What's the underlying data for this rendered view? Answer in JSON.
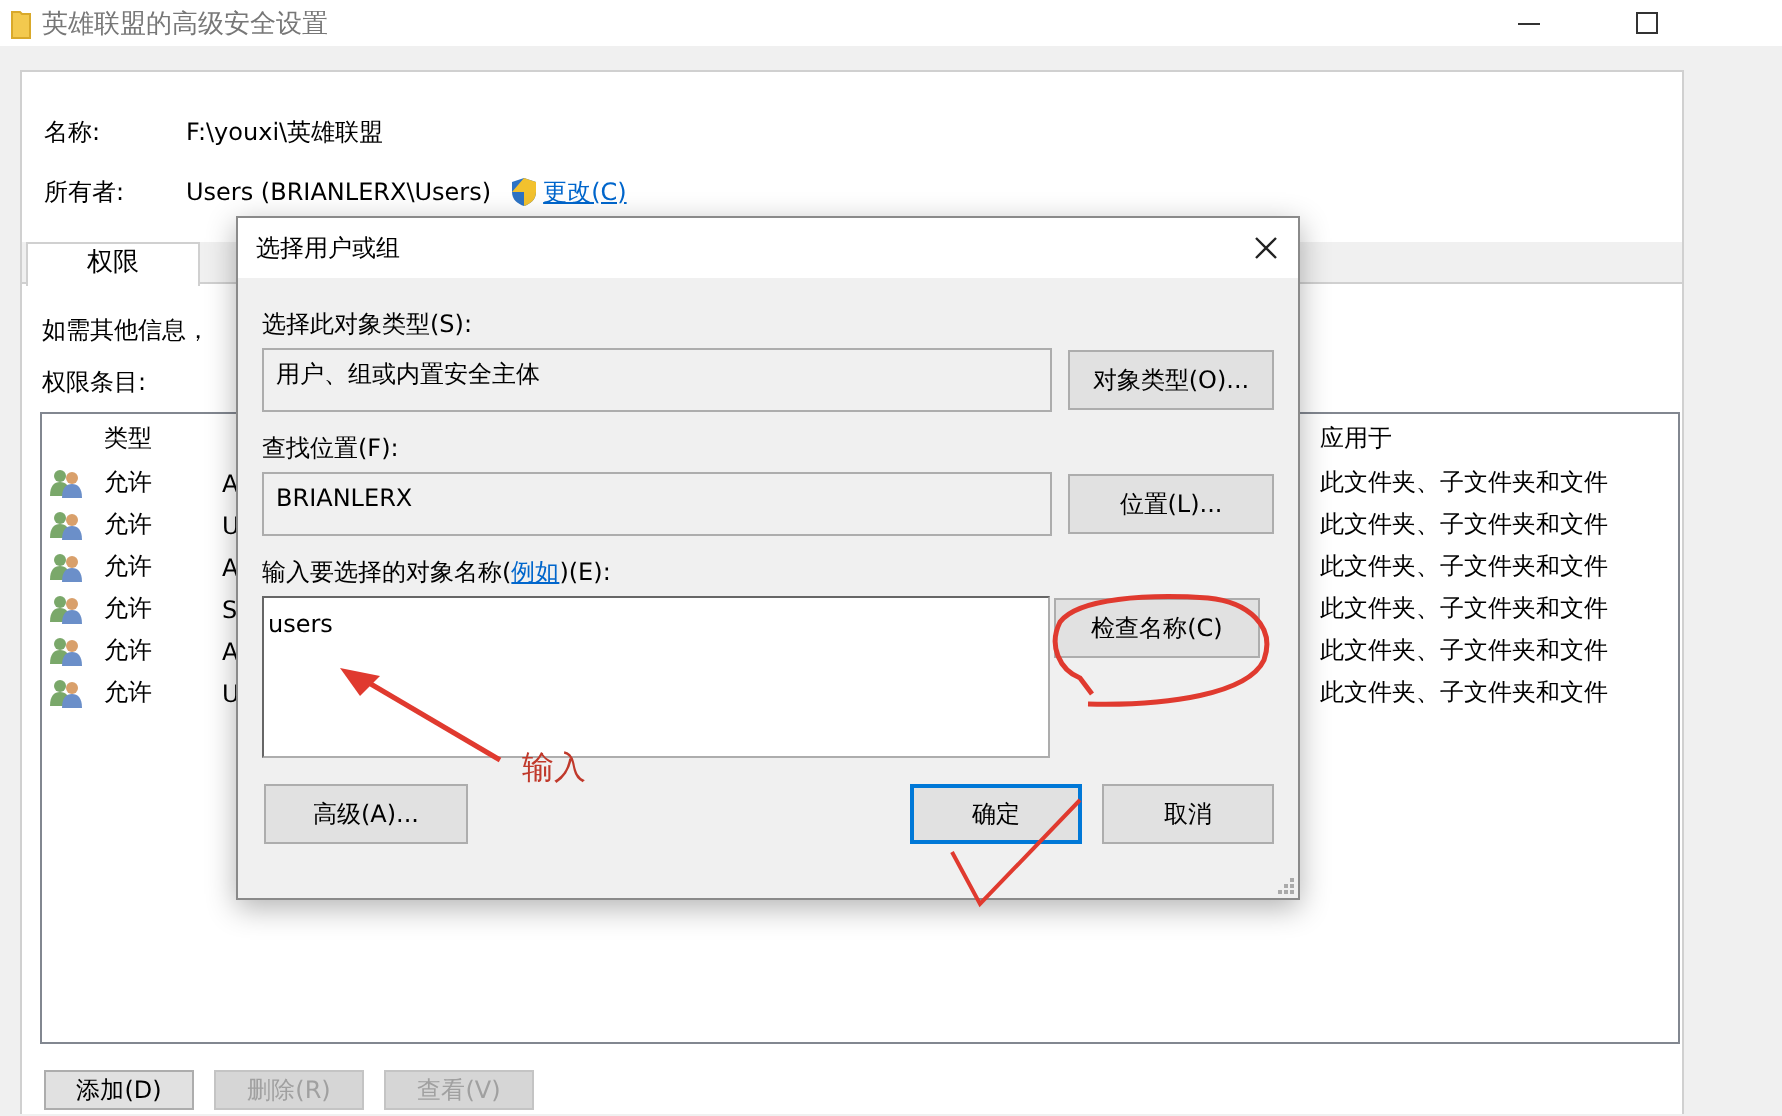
{
  "window": {
    "title": "英雄联盟的高级安全设置"
  },
  "properties": [
    {
      "label": "名称:",
      "value": "F:\\youxi\\英雄联盟"
    },
    {
      "label": "所有者:",
      "value": "Users (BRIANLERX\\Users)",
      "link": "更改(C)"
    }
  ],
  "tabs": [
    {
      "label": "权限",
      "selected": true
    }
  ],
  "info_text": "如需其他信息，",
  "entries_label": "权限条目:",
  "permissions": {
    "columns": {
      "type": "类型",
      "applies_to": "应用于"
    },
    "rows": [
      {
        "type": "允许",
        "principal": "A",
        "applies_to": "此文件夹、子文件夹和文件"
      },
      {
        "type": "允许",
        "principal": "U",
        "applies_to": "此文件夹、子文件夹和文件"
      },
      {
        "type": "允许",
        "principal": "A",
        "applies_to": "此文件夹、子文件夹和文件"
      },
      {
        "type": "允许",
        "principal": "S",
        "applies_to": "此文件夹、子文件夹和文件"
      },
      {
        "type": "允许",
        "principal": "A",
        "applies_to": "此文件夹、子文件夹和文件"
      },
      {
        "type": "允许",
        "principal": "U",
        "applies_to": "此文件夹、子文件夹和文件"
      }
    ]
  },
  "buttons": [
    {
      "label": "添加(D)",
      "disabled": false
    },
    {
      "label": "删除(R)",
      "disabled": true
    },
    {
      "label": "查看(V)",
      "disabled": true
    }
  ],
  "dialog": {
    "title": "选择用户或组",
    "object_type": {
      "label": "选择此对象类型(S):",
      "value": "用户、组或内置安全主体",
      "button": "对象类型(O)..."
    },
    "location": {
      "label": "查找位置(F):",
      "value": "BRIANLERX",
      "button": "位置(L)..."
    },
    "names": {
      "label_before": "输入要选择的对象名称(",
      "link": "例如",
      "label_after": ")(E):",
      "value": "users",
      "button": "检查名称(C)"
    },
    "buttons": [
      {
        "label": "高级(A)...",
        "default": false
      },
      {
        "label": "确定",
        "default": true
      },
      {
        "label": "取消",
        "default": false
      }
    ]
  },
  "annotations": [
    {
      "kind": "arrow"
    },
    {
      "kind": "label",
      "text": "输入"
    },
    {
      "kind": "circle"
    },
    {
      "kind": "check"
    }
  ]
}
